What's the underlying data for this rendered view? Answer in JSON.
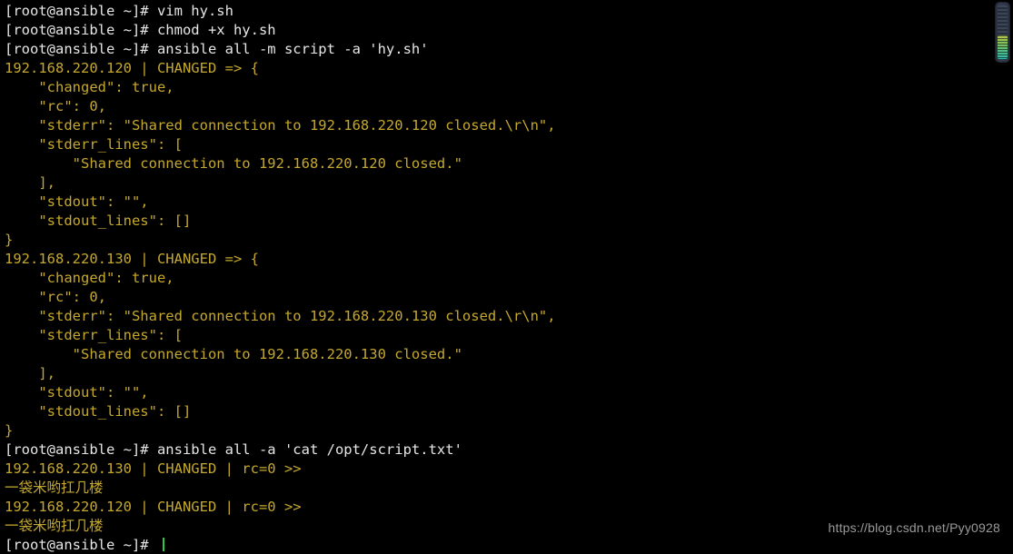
{
  "terminal": {
    "title": "root@ansible terminal",
    "background_color": "#000000",
    "prompt_color": "#e6e6e6",
    "output_color": "#c5a82e",
    "cursor_color": "#2ecc40",
    "cursor_char": "",
    "prompt_string": "[root@ansible ~]#",
    "lines": [
      {
        "type": "prompt",
        "text": "[root@ansible ~]# vim hy.sh"
      },
      {
        "type": "prompt",
        "text": "[root@ansible ~]# chmod +x hy.sh"
      },
      {
        "type": "prompt",
        "text": "[root@ansible ~]# ansible all -m script -a 'hy.sh'"
      },
      {
        "type": "output",
        "text": "192.168.220.120 | CHANGED => {"
      },
      {
        "type": "output",
        "text": "    \"changed\": true,"
      },
      {
        "type": "output",
        "text": "    \"rc\": 0,"
      },
      {
        "type": "output",
        "text": "    \"stderr\": \"Shared connection to 192.168.220.120 closed.\\r\\n\","
      },
      {
        "type": "output",
        "text": "    \"stderr_lines\": ["
      },
      {
        "type": "output",
        "text": "        \"Shared connection to 192.168.220.120 closed.\""
      },
      {
        "type": "output",
        "text": "    ],"
      },
      {
        "type": "output",
        "text": "    \"stdout\": \"\","
      },
      {
        "type": "output",
        "text": "    \"stdout_lines\": []"
      },
      {
        "type": "output",
        "text": "}"
      },
      {
        "type": "output",
        "text": "192.168.220.130 | CHANGED => {"
      },
      {
        "type": "output",
        "text": "    \"changed\": true,"
      },
      {
        "type": "output",
        "text": "    \"rc\": 0,"
      },
      {
        "type": "output",
        "text": "    \"stderr\": \"Shared connection to 192.168.220.130 closed.\\r\\n\","
      },
      {
        "type": "output",
        "text": "    \"stderr_lines\": ["
      },
      {
        "type": "output",
        "text": "        \"Shared connection to 192.168.220.130 closed.\""
      },
      {
        "type": "output",
        "text": "    ],"
      },
      {
        "type": "output",
        "text": "    \"stdout\": \"\","
      },
      {
        "type": "output",
        "text": "    \"stdout_lines\": []"
      },
      {
        "type": "output",
        "text": "}"
      },
      {
        "type": "prompt",
        "text": "[root@ansible ~]# ansible all -a 'cat /opt/script.txt'"
      },
      {
        "type": "output",
        "text": "192.168.220.130 | CHANGED | rc=0 >>"
      },
      {
        "type": "output",
        "text": "一袋米哟扛几楼"
      },
      {
        "type": "output",
        "text": "192.168.220.120 | CHANGED | rc=0 >>"
      },
      {
        "type": "output",
        "text": "一袋米哟扛几楼"
      },
      {
        "type": "cursor",
        "text": "[root@ansible ~]# "
      }
    ]
  },
  "scrollbar": {
    "name": "vertical-scrollbar",
    "track_color": "#2c3444",
    "thumb_gradient_start": "#b7c74e",
    "thumb_gradient_end": "#2fb9a8"
  },
  "watermark": {
    "text": "https://blog.csdn.net/Pyy0928",
    "color": "#9a9a9a"
  }
}
